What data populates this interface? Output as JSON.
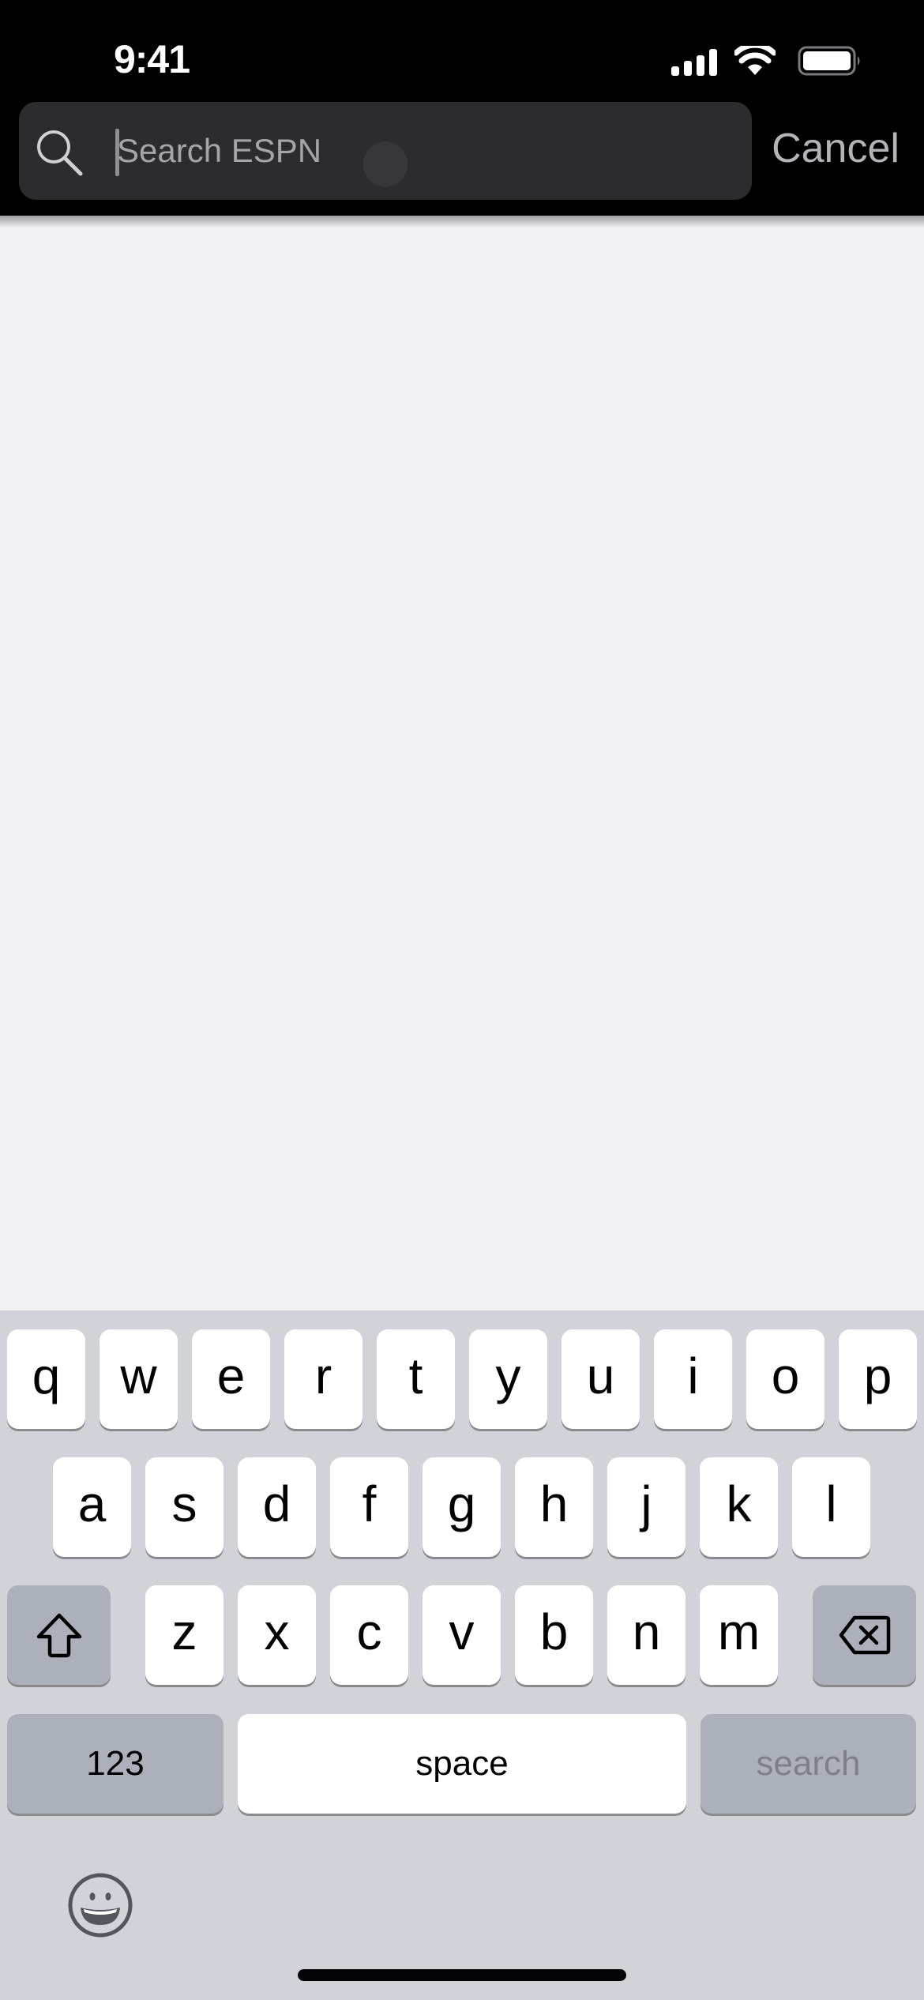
{
  "status_bar": {
    "time": "9:41",
    "icons": [
      "cellular-signal-icon",
      "wifi-icon",
      "battery-icon"
    ]
  },
  "search": {
    "placeholder": "Search ESPN",
    "value": "",
    "icon": "search-icon",
    "cancel_label": "Cancel"
  },
  "keyboard": {
    "rows": [
      [
        "q",
        "w",
        "e",
        "r",
        "t",
        "y",
        "u",
        "i",
        "o",
        "p"
      ],
      [
        "a",
        "s",
        "d",
        "f",
        "g",
        "h",
        "j",
        "k",
        "l"
      ],
      [
        "z",
        "x",
        "c",
        "v",
        "b",
        "n",
        "m"
      ]
    ],
    "shift_icon": "shift-icon",
    "delete_icon": "delete-icon",
    "numbers_label": "123",
    "space_label": "space",
    "return_label": "search",
    "emoji_icon": "emoji-icon"
  },
  "colors": {
    "header_bg": "#000000",
    "search_bg": "#2c2c2e",
    "content_bg": "#f2f2f4",
    "keyboard_bg": "#d1d3d9",
    "key_bg": "#ffffff",
    "func_key_bg": "#acb0bb"
  }
}
